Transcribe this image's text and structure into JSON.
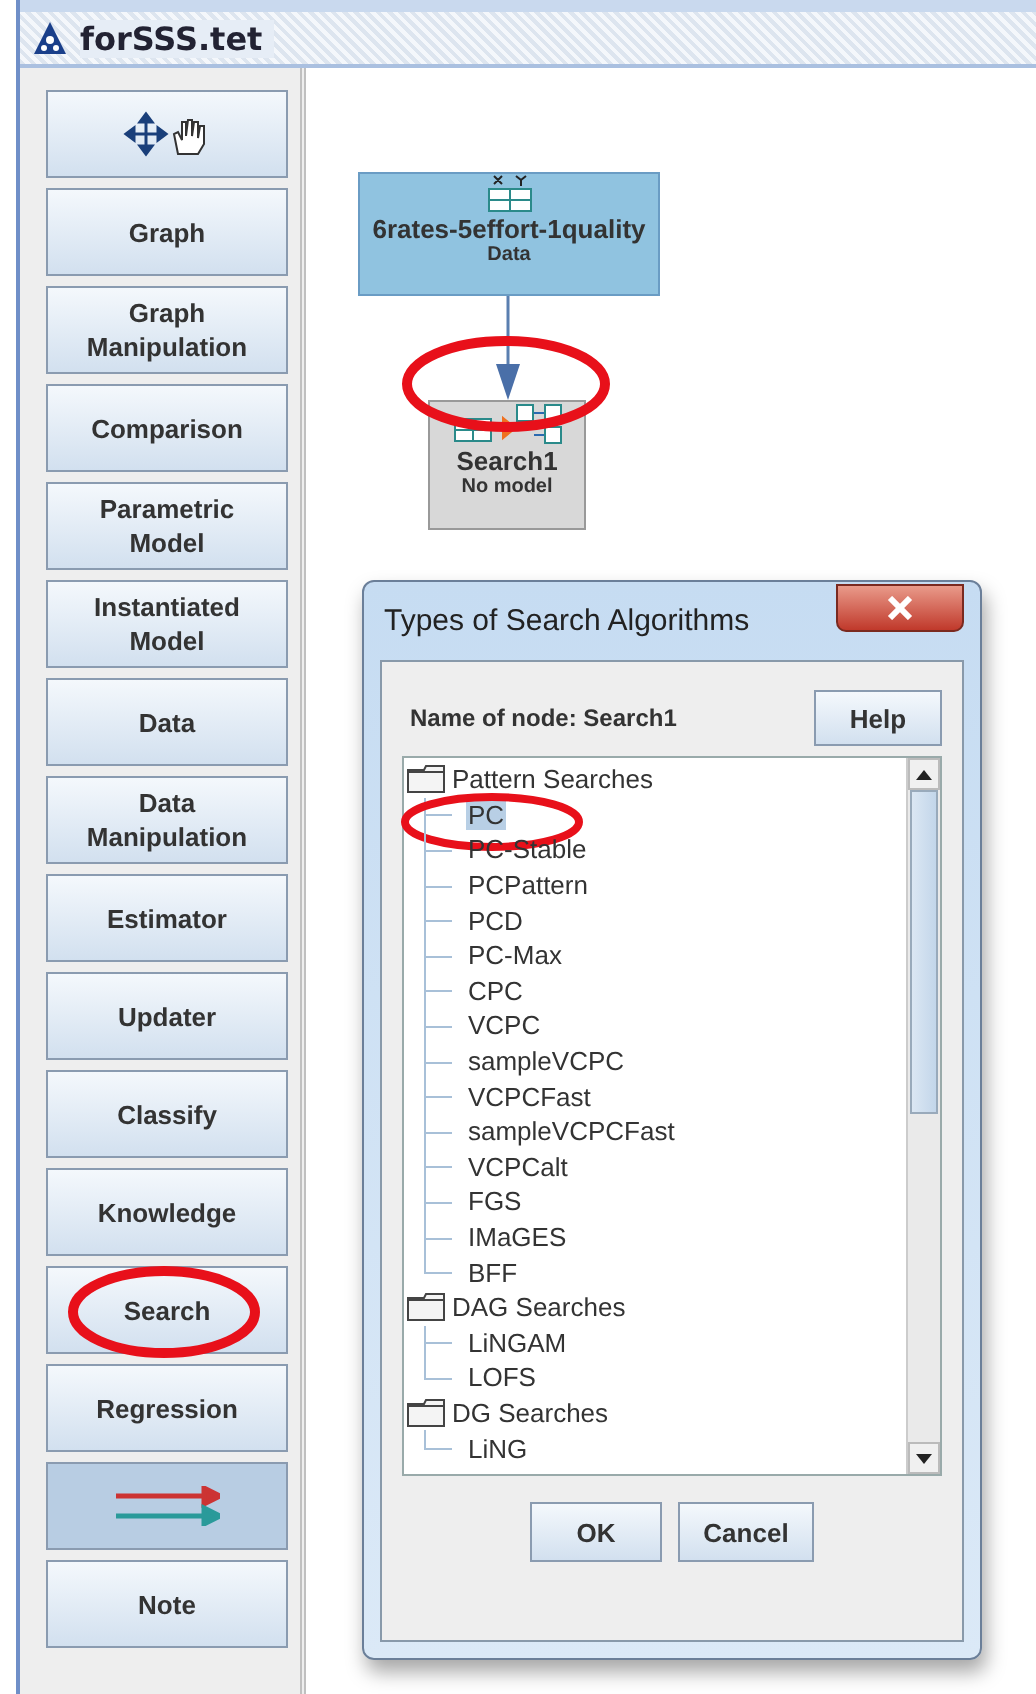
{
  "window": {
    "title": "forSSS.tet"
  },
  "toolbox": [
    {
      "kind": "move",
      "selected": false,
      "circled": false
    },
    {
      "kind": "text",
      "label": "Graph",
      "selected": false,
      "circled": false
    },
    {
      "kind": "text",
      "label": "Graph Manipulation",
      "selected": false,
      "circled": false
    },
    {
      "kind": "text",
      "label": "Comparison",
      "selected": false,
      "circled": false
    },
    {
      "kind": "text",
      "label": "Parametric Model",
      "selected": false,
      "circled": false
    },
    {
      "kind": "text",
      "label": "Instantiated Model",
      "selected": false,
      "circled": false
    },
    {
      "kind": "text",
      "label": "Data",
      "selected": false,
      "circled": false
    },
    {
      "kind": "text",
      "label": "Data Manipulation",
      "selected": false,
      "circled": false
    },
    {
      "kind": "text",
      "label": "Estimator",
      "selected": false,
      "circled": false
    },
    {
      "kind": "text",
      "label": "Updater",
      "selected": false,
      "circled": false
    },
    {
      "kind": "text",
      "label": "Classify",
      "selected": false,
      "circled": false
    },
    {
      "kind": "text",
      "label": "Knowledge",
      "selected": false,
      "circled": false
    },
    {
      "kind": "text",
      "label": "Search",
      "selected": false,
      "circled": true
    },
    {
      "kind": "text",
      "label": "Regression",
      "selected": false,
      "circled": false
    },
    {
      "kind": "edge",
      "selected": true,
      "circled": false
    },
    {
      "kind": "text",
      "label": "Note",
      "selected": false,
      "circled": false
    }
  ],
  "canvas": {
    "nodes": [
      {
        "kind": "data",
        "name": "6rates-5effort-1quality",
        "subtitle": "Data"
      },
      {
        "kind": "search",
        "name": "Search1",
        "subtitle": "No model"
      }
    ],
    "edge": {
      "circled": true
    }
  },
  "dialog": {
    "title": "Types of Search Algorithms",
    "node_label": "Name of node: Search1",
    "help_button": "Help",
    "tree": [
      {
        "label": "Pattern Searches",
        "children": [
          {
            "label": "PC",
            "selected": true,
            "circled": true
          },
          {
            "label": "PC-Stable",
            "selected": false,
            "circled": false
          },
          {
            "label": "PCPattern",
            "selected": false,
            "circled": false
          },
          {
            "label": "PCD",
            "selected": false,
            "circled": false
          },
          {
            "label": "PC-Max",
            "selected": false,
            "circled": false
          },
          {
            "label": "CPC",
            "selected": false,
            "circled": false
          },
          {
            "label": "VCPC",
            "selected": false,
            "circled": false
          },
          {
            "label": "sampleVCPC",
            "selected": false,
            "circled": false
          },
          {
            "label": "VCPCFast",
            "selected": false,
            "circled": false
          },
          {
            "label": "sampleVCPCFast",
            "selected": false,
            "circled": false
          },
          {
            "label": "VCPCalt",
            "selected": false,
            "circled": false
          },
          {
            "label": "FGS",
            "selected": false,
            "circled": false
          },
          {
            "label": "IMaGES",
            "selected": false,
            "circled": false
          },
          {
            "label": "BFF",
            "selected": false,
            "circled": false
          }
        ]
      },
      {
        "label": "DAG Searches",
        "children": [
          {
            "label": "LiNGAM",
            "selected": false,
            "circled": false
          },
          {
            "label": "LOFS",
            "selected": false,
            "circled": false
          }
        ]
      },
      {
        "label": "DG Searches",
        "children": [
          {
            "label": "LiNG",
            "selected": false,
            "circled": false
          }
        ]
      }
    ],
    "buttons": [
      "OK",
      "Cancel"
    ]
  }
}
